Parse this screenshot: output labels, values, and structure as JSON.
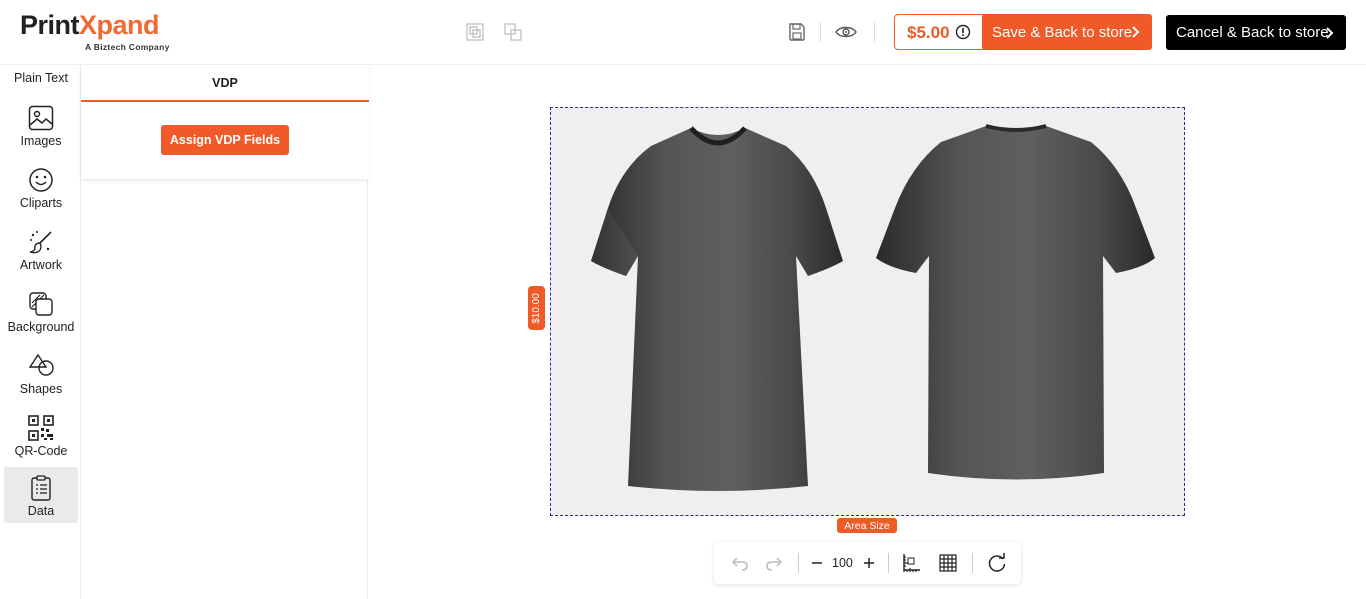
{
  "brand": {
    "name_part1": "Print",
    "name_part2": "Xpand",
    "tagline": "A Biztech Company",
    "accent_color": "#f05a28"
  },
  "header": {
    "price": "$5.00",
    "save_label": "Save & Back to store",
    "cancel_label": "Cancel & Back to store",
    "icons": [
      "group-icon",
      "ungroup-icon",
      "save-icon",
      "preview-eye-icon",
      "info-icon"
    ]
  },
  "sidebar": {
    "partial_item": "Plain Text",
    "items": [
      {
        "label": "Images",
        "icon": "image-icon"
      },
      {
        "label": "Cliparts",
        "icon": "smiley-icon"
      },
      {
        "label": "Artwork",
        "icon": "artwork-brush-icon"
      },
      {
        "label": "Background",
        "icon": "background-icon"
      },
      {
        "label": "Shapes",
        "icon": "shapes-icon"
      },
      {
        "label": "QR-Code",
        "icon": "qr-code-icon"
      },
      {
        "label": "Data",
        "icon": "clipboard-data-icon",
        "active": true
      }
    ]
  },
  "panel": {
    "tab": "VDP",
    "assign_label": "Assign VDP Fields"
  },
  "canvas": {
    "price_tag": "$10.00",
    "area_label": "Area Size"
  },
  "toolbar": {
    "zoom": "100",
    "icons": [
      "undo-icon",
      "redo-icon",
      "zoom-out-icon",
      "zoom-in-icon",
      "ruler-icon",
      "grid-icon",
      "reset-icon"
    ]
  }
}
